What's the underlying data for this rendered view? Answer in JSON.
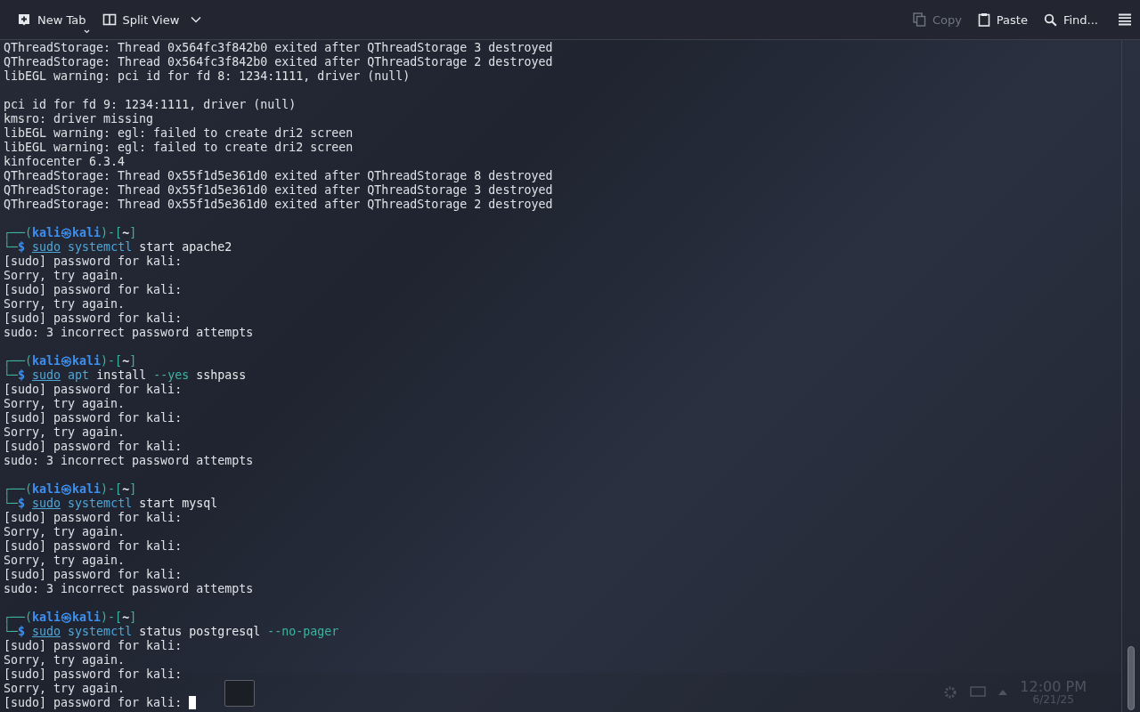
{
  "toolbar": {
    "left": [
      {
        "label": "New Tab",
        "kind": "new-tab",
        "disabled": false
      },
      {
        "label": "Split View",
        "kind": "split",
        "disabled": false
      }
    ],
    "right": [
      {
        "label": "Copy",
        "kind": "copy",
        "disabled": true
      },
      {
        "label": "Paste",
        "kind": "paste",
        "disabled": false
      },
      {
        "label": "Find...",
        "kind": "search",
        "disabled": false
      }
    ]
  },
  "terminal": {
    "lines": [
      {
        "kind": "text",
        "text": "QThreadStorage: Thread 0x564fc3f842b0 exited after QThreadStorage 3 destroyed"
      },
      {
        "kind": "text",
        "text": "QThreadStorage: Thread 0x564fc3f842b0 exited after QThreadStorage 2 destroyed"
      },
      {
        "kind": "text",
        "text": "libEGL warning: pci id for fd 8: 1234:1111, driver (null)"
      },
      {
        "kind": "blank"
      },
      {
        "kind": "text",
        "text": "pci id for fd 9: 1234:1111, driver (null)"
      },
      {
        "kind": "text",
        "text": "kmsro: driver missing"
      },
      {
        "kind": "text",
        "text": "libEGL warning: egl: failed to create dri2 screen"
      },
      {
        "kind": "text",
        "text": "libEGL warning: egl: failed to create dri2 screen"
      },
      {
        "kind": "text",
        "text": "kinfocenter 6.3.4"
      },
      {
        "kind": "text",
        "text": "QThreadStorage: Thread 0x55f1d5e361d0 exited after QThreadStorage 8 destroyed"
      },
      {
        "kind": "text",
        "text": "QThreadStorage: Thread 0x55f1d5e361d0 exited after QThreadStorage 3 destroyed"
      },
      {
        "kind": "text",
        "text": "QThreadStorage: Thread 0x55f1d5e361d0 exited after QThreadStorage 2 destroyed"
      },
      {
        "kind": "blank"
      },
      {
        "kind": "prompt",
        "open": "┌──(",
        "user": "kali",
        "at": "㉿",
        "host": "kali",
        "mid": ")-[",
        "dir": "~",
        "close": "]"
      },
      {
        "kind": "command",
        "corner": "└─",
        "dollar": "$",
        "parts": [
          {
            "text": "sudo",
            "kind": "sudo"
          },
          {
            "text": "systemctl",
            "kind": "program"
          },
          {
            "text": "start",
            "kind": "arg"
          },
          {
            "text": "apache2",
            "kind": "arg"
          }
        ]
      },
      {
        "kind": "text",
        "text": "[sudo] password for kali:"
      },
      {
        "kind": "text",
        "text": "Sorry, try again."
      },
      {
        "kind": "text",
        "text": "[sudo] password for kali:"
      },
      {
        "kind": "text",
        "text": "Sorry, try again."
      },
      {
        "kind": "text",
        "text": "[sudo] password for kali:"
      },
      {
        "kind": "text",
        "text": "sudo: 3 incorrect password attempts"
      },
      {
        "kind": "blank"
      },
      {
        "kind": "prompt",
        "open": "┌──(",
        "user": "kali",
        "at": "㉿",
        "host": "kali",
        "mid": ")-[",
        "dir": "~",
        "close": "]"
      },
      {
        "kind": "command",
        "corner": "└─",
        "dollar": "$",
        "parts": [
          {
            "text": "sudo",
            "kind": "sudo"
          },
          {
            "text": "apt",
            "kind": "program"
          },
          {
            "text": "install",
            "kind": "arg"
          },
          {
            "text": "--yes",
            "kind": "option"
          },
          {
            "text": "sshpass",
            "kind": "arg"
          }
        ]
      },
      {
        "kind": "text",
        "text": "[sudo] password for kali:"
      },
      {
        "kind": "text",
        "text": "Sorry, try again."
      },
      {
        "kind": "text",
        "text": "[sudo] password for kali:"
      },
      {
        "kind": "text",
        "text": "Sorry, try again."
      },
      {
        "kind": "text",
        "text": "[sudo] password for kali:"
      },
      {
        "kind": "text",
        "text": "sudo: 3 incorrect password attempts"
      },
      {
        "kind": "blank"
      },
      {
        "kind": "prompt",
        "open": "┌──(",
        "user": "kali",
        "at": "㉿",
        "host": "kali",
        "mid": ")-[",
        "dir": "~",
        "close": "]"
      },
      {
        "kind": "command",
        "corner": "└─",
        "dollar": "$",
        "parts": [
          {
            "text": "sudo",
            "kind": "sudo"
          },
          {
            "text": "systemctl",
            "kind": "program"
          },
          {
            "text": "start",
            "kind": "arg"
          },
          {
            "text": "mysql",
            "kind": "arg"
          }
        ]
      },
      {
        "kind": "text",
        "text": "[sudo] password for kali:"
      },
      {
        "kind": "text",
        "text": "Sorry, try again."
      },
      {
        "kind": "text",
        "text": "[sudo] password for kali:"
      },
      {
        "kind": "text",
        "text": "Sorry, try again."
      },
      {
        "kind": "text",
        "text": "[sudo] password for kali:"
      },
      {
        "kind": "text",
        "text": "sudo: 3 incorrect password attempts"
      },
      {
        "kind": "blank"
      },
      {
        "kind": "prompt",
        "open": "┌──(",
        "user": "kali",
        "at": "㉿",
        "host": "kali",
        "mid": ")-[",
        "dir": "~",
        "close": "]"
      },
      {
        "kind": "command",
        "corner": "└─",
        "dollar": "$",
        "parts": [
          {
            "text": "sudo",
            "kind": "sudo"
          },
          {
            "text": "systemctl",
            "kind": "program"
          },
          {
            "text": "status",
            "kind": "arg"
          },
          {
            "text": "postgresql",
            "kind": "arg"
          },
          {
            "text": "--no-pager",
            "kind": "option"
          }
        ]
      },
      {
        "kind": "text",
        "text": "[sudo] password for kali:"
      },
      {
        "kind": "text",
        "text": "Sorry, try again."
      },
      {
        "kind": "text",
        "text": "[sudo] password for kali:"
      },
      {
        "kind": "text",
        "text": "Sorry, try again."
      },
      {
        "kind": "text",
        "text": "[sudo] password for kali:",
        "cursor": true
      }
    ]
  },
  "taskbar_behind": {
    "time": "12:00 PM",
    "date": "6/21/25"
  }
}
